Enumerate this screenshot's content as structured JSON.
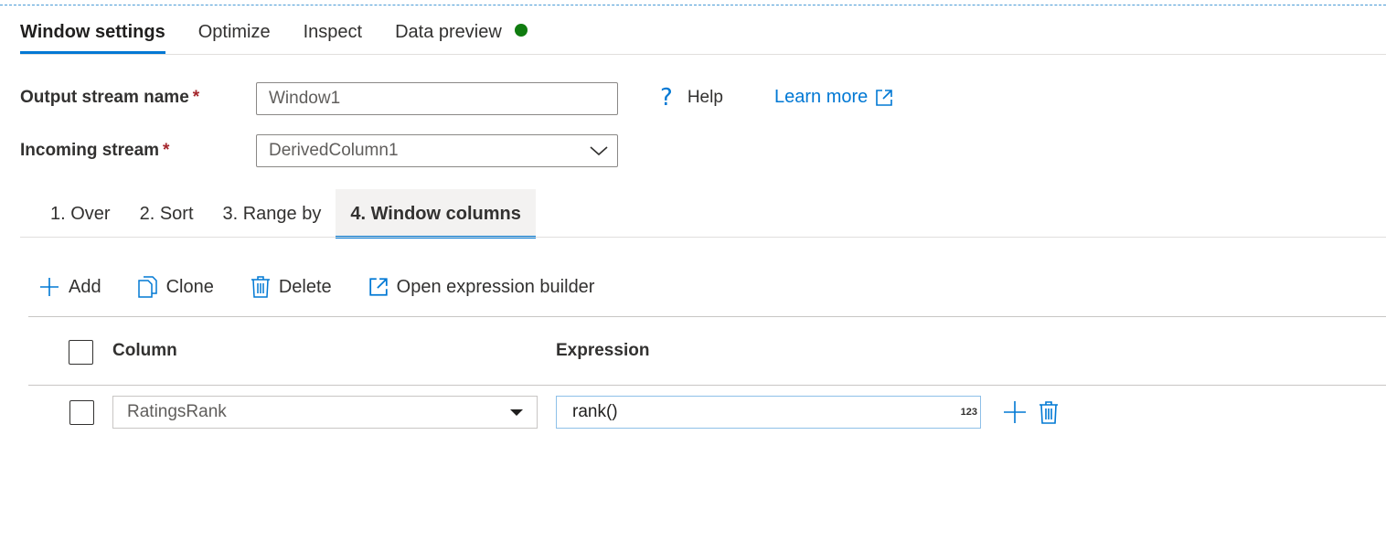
{
  "main_tabs": [
    {
      "label": "Window settings",
      "active": true
    },
    {
      "label": "Optimize",
      "active": false
    },
    {
      "label": "Inspect",
      "active": false
    },
    {
      "label": "Data preview",
      "active": false,
      "status": "green-dot"
    }
  ],
  "form": {
    "output_stream": {
      "label": "Output stream name",
      "required_mark": "*",
      "value": "Window1"
    },
    "incoming_stream": {
      "label": "Incoming stream",
      "required_mark": "*",
      "value": "DerivedColumn1"
    },
    "help_label": "Help",
    "learn_more_label": "Learn more"
  },
  "sub_tabs": [
    {
      "label": "1. Over",
      "active": false
    },
    {
      "label": "2. Sort",
      "active": false
    },
    {
      "label": "3. Range by",
      "active": false
    },
    {
      "label": "4. Window columns",
      "active": true
    }
  ],
  "toolbar": {
    "add_label": "Add",
    "clone_label": "Clone",
    "delete_label": "Delete",
    "open_expression_builder_label": "Open expression builder"
  },
  "table": {
    "headers": {
      "column": "Column",
      "expression": "Expression"
    },
    "rows": [
      {
        "column": "RatingsRank",
        "expression": "rank()",
        "type_badge": "123"
      }
    ]
  },
  "colors": {
    "accent": "#0078d4",
    "status_ok": "#107c10",
    "required": "#a4262c"
  }
}
